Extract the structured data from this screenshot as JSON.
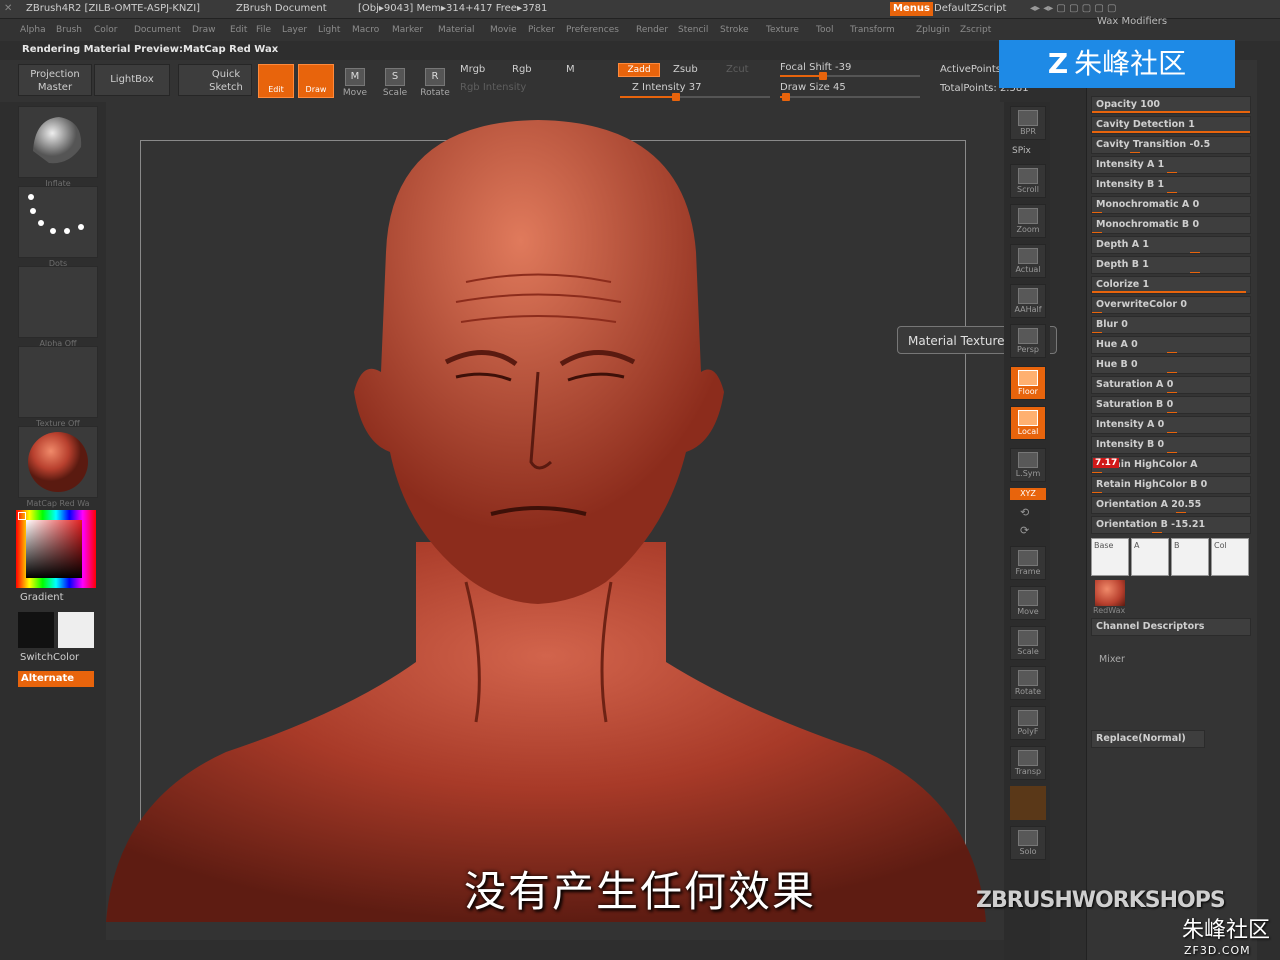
{
  "titlebar": {
    "app": "ZBrush4R2 [ZILB-OMTE-ASPJ-KNZI]",
    "doc": "ZBrush Document",
    "stats": "[Obj▸9043] Mem▸314+417 Free▸3781",
    "menus_btn": "Menus",
    "script": "DefaultZScript"
  },
  "menubar": [
    "Alpha",
    "Brush",
    "Color",
    "Document",
    "Draw",
    "Edit",
    "File",
    "Layer",
    "Light",
    "Macro",
    "Marker",
    "Material",
    "Movie",
    "Picker",
    "Preferences",
    "Render",
    "Stencil",
    "Stroke",
    "Texture",
    "Tool",
    "Transform",
    "Zplugin",
    "Zscript"
  ],
  "status_line": "Rendering Material Preview:MatCap Red Wax",
  "toolbar": {
    "projection_master": "Projection Master",
    "lightbox": "LightBox",
    "quick_sketch": "Quick Sketch",
    "edit": "Edit",
    "draw": "Draw",
    "move": "Move",
    "scale": "Scale",
    "rotate": "Rotate",
    "mrgb": "Mrgb",
    "rgb": "Rgb",
    "m": "M",
    "zadd": "Zadd",
    "zsub": "Zsub",
    "zcut": "Zcut",
    "z_intensity": "Z Intensity 37",
    "rgb_intensity": "Rgb Intensity",
    "focal_shift": "Focal Shift -39",
    "draw_size": "Draw Size 45",
    "active_points": "ActivePoints:",
    "total_points": "TotalPoints: 2.581"
  },
  "toolbar_values": {
    "z_intensity": 37,
    "focal_shift": -39,
    "draw_size": 45
  },
  "left_shelf": {
    "brush_cap": "Inflate",
    "stroke_cap": "Dots",
    "alpha_cap": "Alpha Off",
    "texture_cap": "Texture Off",
    "material_cap": "MatCap Red Wa",
    "gradient": "Gradient",
    "switch_color": "SwitchColor",
    "alternate": "Alternate"
  },
  "right_shelf": {
    "bpr": "BPR",
    "spix": "SPix",
    "scroll": "Scroll",
    "zoom": "Zoom",
    "actual": "Actual",
    "aahalf": "AAHalf",
    "persp": "Persp",
    "floor": "Floor",
    "local": "Local",
    "lsym": "L.Sym",
    "xyz": "XYZ",
    "frame": "Frame",
    "move": "Move",
    "scale": "Scale",
    "rotate": "Rotate",
    "polyf": "PolyF",
    "transp": "Transp",
    "solo": "Solo"
  },
  "tooltip": "Material Texture 3",
  "right_panel": {
    "header": "Wax Modifiers",
    "rows": [
      {
        "label": "Opacity 100",
        "fill": 1.0
      },
      {
        "label": "Cavity Detection 1",
        "fill": 1.0
      },
      {
        "label": "Cavity Transition -0.5",
        "fill": 0.25
      },
      {
        "label": "Intensity A 1",
        "fill": 0.5
      },
      {
        "label": "Intensity B 1",
        "fill": 0.5
      },
      {
        "label": "Monochromatic A 0",
        "fill": 0
      },
      {
        "label": "Monochromatic B 0",
        "fill": 0
      },
      {
        "label": "Depth A 1",
        "fill": 0.65
      },
      {
        "label": "Depth B 1",
        "fill": 0.65
      },
      {
        "label": "Colorize 1",
        "fill": 0.96
      },
      {
        "label": "OverwriteColor 0",
        "fill": 0
      },
      {
        "label": "Blur 0",
        "fill": 0
      },
      {
        "label": "Hue A 0",
        "fill": 0.5
      },
      {
        "label": "Hue B 0",
        "fill": 0.5
      },
      {
        "label": "Saturation A 0",
        "fill": 0.5
      },
      {
        "label": "Saturation B 0",
        "fill": 0.5
      },
      {
        "label": "Intensity A 0",
        "fill": 0.5
      },
      {
        "label": "Intensity B 0",
        "fill": 0.5
      },
      {
        "label": "Retain HighColor A",
        "fill": 0.0
      },
      {
        "label": "Retain HighColor B 0",
        "fill": 0
      },
      {
        "label": "Orientation A 20.55",
        "fill": 0.56
      },
      {
        "label": "Orientation B -15.21",
        "fill": 0.4
      }
    ],
    "retain_value_badge": "7.17",
    "channels": [
      "Base",
      "A",
      "B",
      "Col"
    ],
    "material_name": "RedWax",
    "channel_descriptors": "Channel Descriptors",
    "mixer": "Mixer",
    "replace_normal": "Replace(Normal)"
  },
  "subtitle": "没有产生任何效果",
  "watermark_top": "朱峰社区",
  "watermark_bottom": "朱峰社区",
  "watermark_bottom_url": "ZF3D.COM",
  "workshops": "ZBRUSHWORKSHOPS",
  "colors": {
    "accent": "#e8640c",
    "wax": "#b8402e",
    "background": "#333333"
  }
}
